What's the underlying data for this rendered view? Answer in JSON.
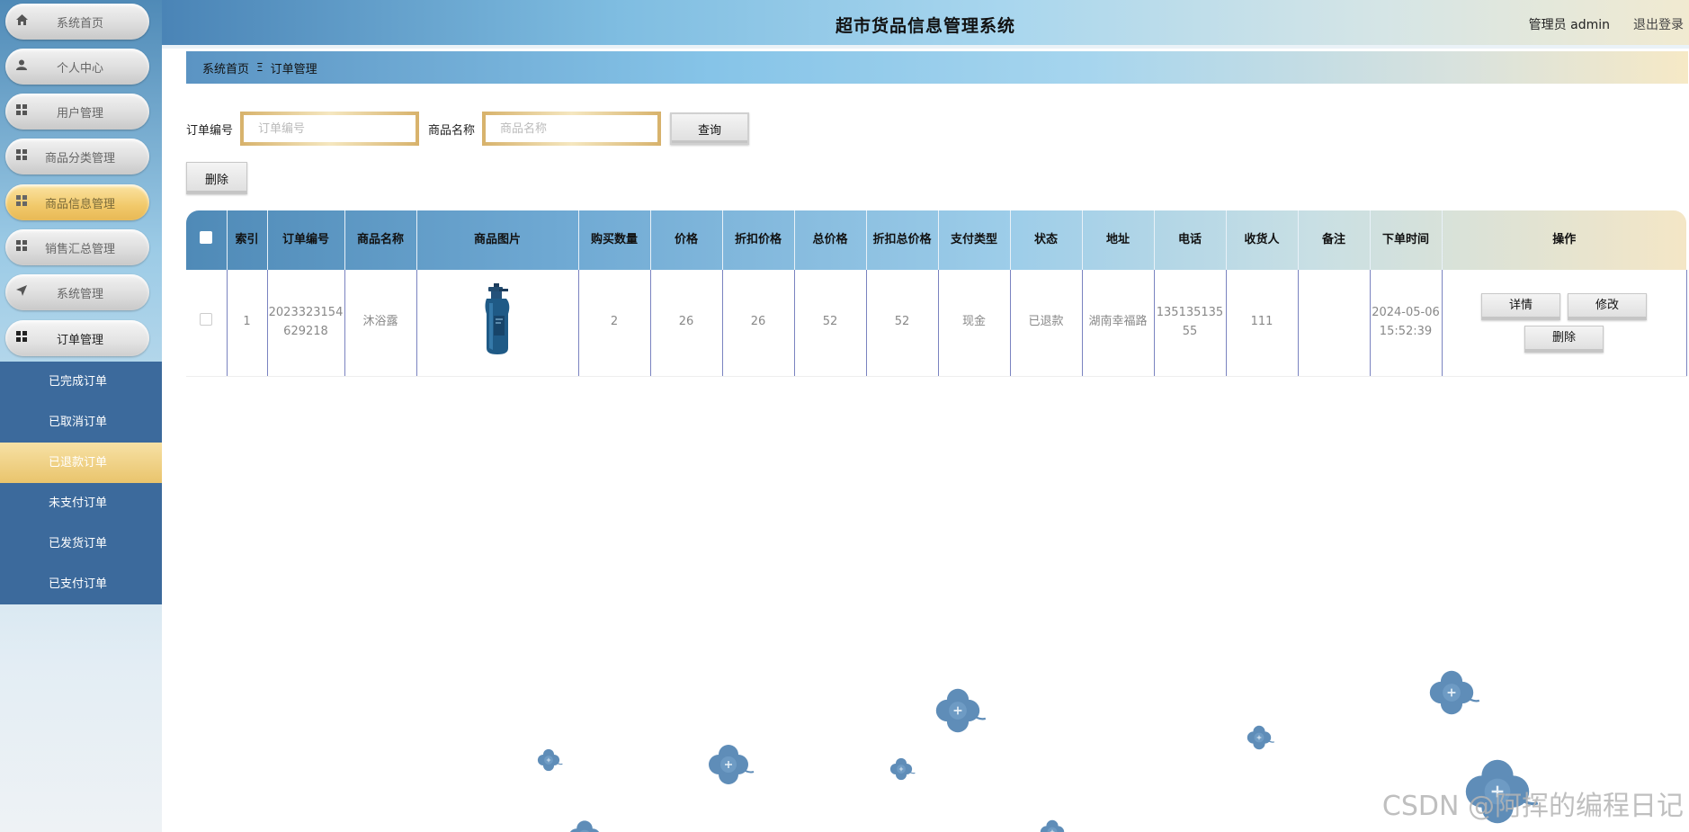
{
  "header": {
    "title": "超市货品信息管理系统",
    "user": "管理员 admin",
    "logout": "退出登录"
  },
  "sidebar": {
    "items": [
      {
        "label": "系统首页",
        "icon": "home-icon"
      },
      {
        "label": "个人中心",
        "icon": "person-icon"
      },
      {
        "label": "用户管理",
        "icon": "grid-icon"
      },
      {
        "label": "商品分类管理",
        "icon": "grid-icon"
      },
      {
        "label": "商品信息管理",
        "icon": "grid-icon"
      },
      {
        "label": "销售汇总管理",
        "icon": "grid-icon"
      },
      {
        "label": "系统管理",
        "icon": "send-icon"
      },
      {
        "label": "订单管理",
        "icon": "grid-icon"
      }
    ],
    "submenu": [
      {
        "label": "已完成订单"
      },
      {
        "label": "已取消订单"
      },
      {
        "label": "已退款订单"
      },
      {
        "label": "未支付订单"
      },
      {
        "label": "已发货订单"
      },
      {
        "label": "已支付订单"
      }
    ]
  },
  "breadcrumb": {
    "home": "系统首页",
    "separator": "Ξ",
    "current": "订单管理"
  },
  "search": {
    "order_no_label": "订单编号",
    "order_no_placeholder": "订单编号",
    "order_no_value": "",
    "product_name_label": "商品名称",
    "product_name_placeholder": "商品名称",
    "product_name_value": "",
    "query_button": "查询"
  },
  "toolbar": {
    "delete_button": "删除"
  },
  "table": {
    "headers": [
      "索引",
      "订单编号",
      "商品名称",
      "商品图片",
      "购买数量",
      "价格",
      "折扣价格",
      "总价格",
      "折扣总价格",
      "支付类型",
      "状态",
      "地址",
      "电话",
      "收货人",
      "备注",
      "下单时间",
      "操作"
    ],
    "rows": [
      {
        "index": "1",
        "order_no": "2023323154629218",
        "product_name": "沐浴露",
        "image_icon": "shower-gel-bottle-image",
        "quantity": "2",
        "price": "26",
        "discount_price": "26",
        "total_price": "52",
        "discount_total": "52",
        "pay_type": "现金",
        "status": "已退款",
        "address": "湖南幸福路",
        "phone": "13513513555",
        "receiver": "111",
        "remark": "",
        "order_time": "2024-05-06 15:52:39",
        "actions": {
          "detail": "详情",
          "edit": "修改",
          "delete": "删除"
        }
      }
    ]
  },
  "watermark": "CSDN @阿挥的编程日记",
  "colors": {
    "sidebar_submenu_bg": "#3c6a9c",
    "active_gold": "#e9c46c",
    "header_blue": "#4a84b6",
    "table_border": "#7a83c0"
  }
}
